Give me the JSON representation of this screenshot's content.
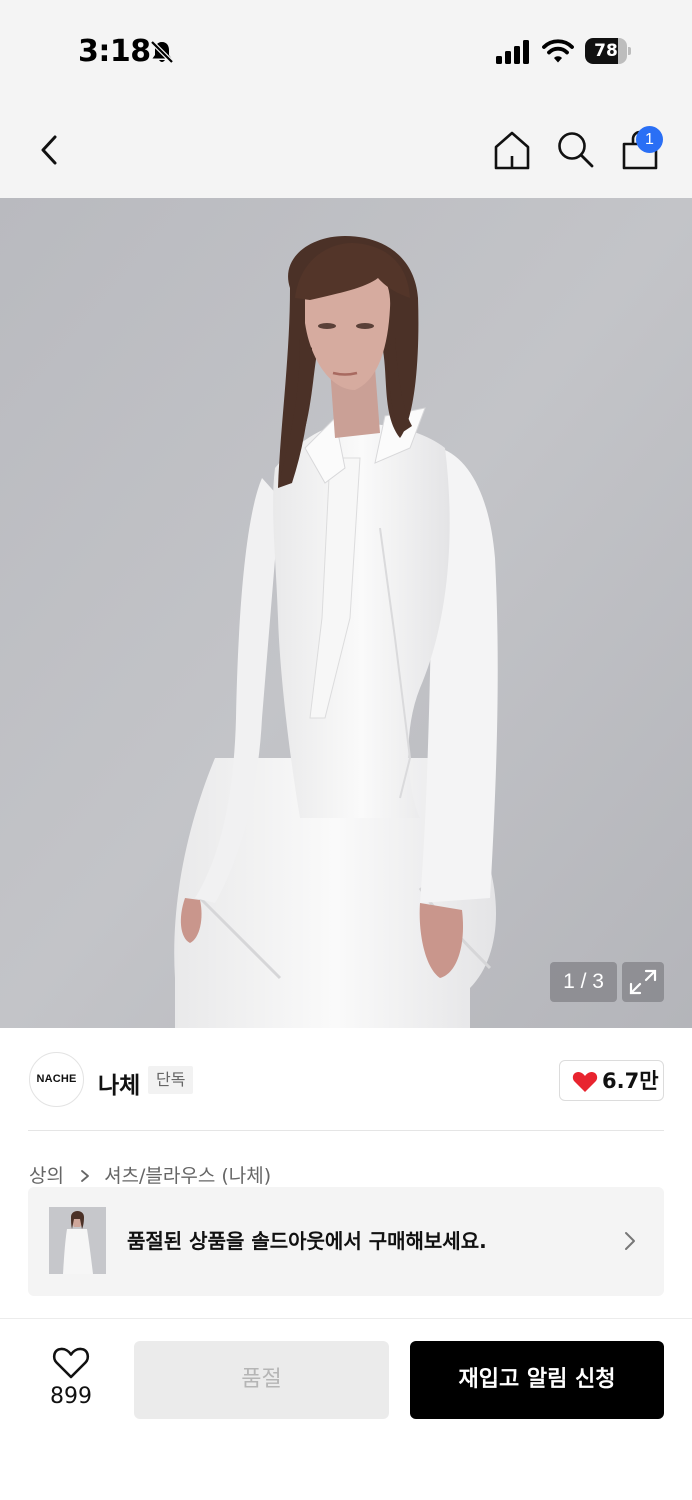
{
  "status_bar": {
    "time": "3:18",
    "battery": "78",
    "battery_level": 0.78,
    "icons": [
      "bell-slash-icon",
      "signal-icon",
      "wifi-icon",
      "battery-icon"
    ]
  },
  "nav": {
    "icons": [
      "chevron-left-icon",
      "home-icon",
      "search-icon",
      "shopping-bag-icon"
    ],
    "cart_badge": "1",
    "badge_color": "#2a6ff5"
  },
  "gallery": {
    "indicator": "1 / 3",
    "expand_icon": "expand-icon"
  },
  "brand": {
    "logo_text": "NACHE",
    "name": "나체",
    "tag": "단독",
    "likes": "6.7만",
    "heart_color": "#e8242f"
  },
  "breadcrumb": {
    "category": "상의",
    "subcategory": "셔츠/블라우스 (나체)"
  },
  "soldout_banner": {
    "text": "품절된 상품을 솔드아웃에서 구매해보세요."
  },
  "bottom_bar": {
    "wish_count": "899",
    "soldout_label": "품절",
    "restock_label": "재입고 알림 신청"
  }
}
